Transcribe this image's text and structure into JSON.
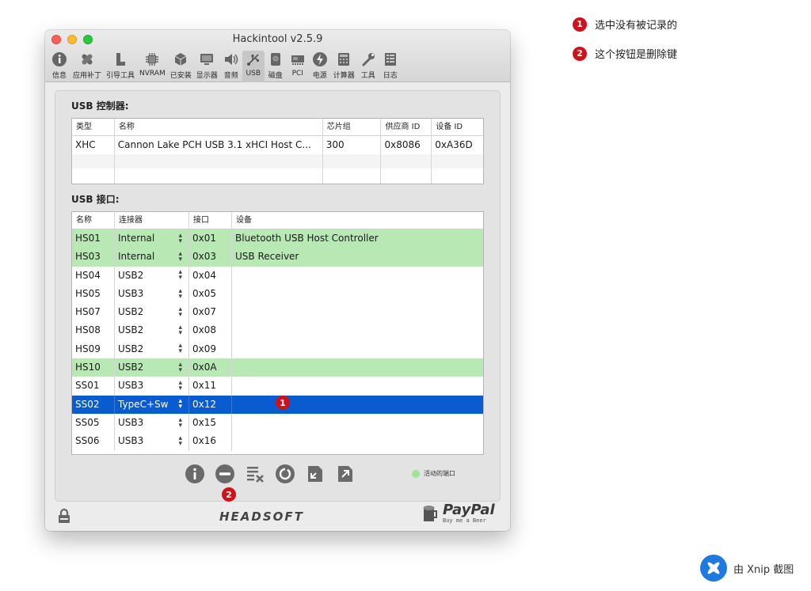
{
  "window": {
    "title": "Hackintool v2.5.9"
  },
  "toolbar": {
    "items": [
      {
        "label": "信息",
        "icon": "info-icon"
      },
      {
        "label": "应用补丁",
        "icon": "patch-icon"
      },
      {
        "label": "引导工具",
        "icon": "boot-icon"
      },
      {
        "label": "NVRAM",
        "icon": "chip-icon"
      },
      {
        "label": "已安装",
        "icon": "box-icon"
      },
      {
        "label": "显示器",
        "icon": "display-icon"
      },
      {
        "label": "音频",
        "icon": "speaker-icon"
      },
      {
        "label": "USB",
        "icon": "usb-icon",
        "active": true
      },
      {
        "label": "磁盘",
        "icon": "disk-icon"
      },
      {
        "label": "PCI",
        "icon": "pci-icon"
      },
      {
        "label": "电源",
        "icon": "power-icon"
      },
      {
        "label": "计算器",
        "icon": "calculator-icon"
      },
      {
        "label": "工具",
        "icon": "wrench-icon"
      },
      {
        "label": "日志",
        "icon": "log-icon"
      }
    ]
  },
  "controllers": {
    "title": "USB 控制器:",
    "headers": [
      "类型",
      "名称",
      "芯片组",
      "供应商 ID",
      "设备 ID"
    ],
    "rows": [
      [
        "XHC",
        "Cannon Lake PCH USB 3.1 xHCI Host C...",
        "300",
        "0x8086",
        "0xA36D"
      ]
    ]
  },
  "ports": {
    "title": "USB 接口:",
    "headers": [
      "名称",
      "连接器",
      "接口",
      "设备"
    ],
    "rows": [
      {
        "name": "HS01",
        "connector": "Internal",
        "port": "0x01",
        "device": "Bluetooth USB Host Controller",
        "state": "green"
      },
      {
        "name": "HS03",
        "connector": "Internal",
        "port": "0x03",
        "device": "USB Receiver",
        "state": "green"
      },
      {
        "name": "HS04",
        "connector": "USB2",
        "port": "0x04",
        "device": "",
        "state": ""
      },
      {
        "name": "HS05",
        "connector": "USB3",
        "port": "0x05",
        "device": "",
        "state": ""
      },
      {
        "name": "HS07",
        "connector": "USB2",
        "port": "0x07",
        "device": "",
        "state": ""
      },
      {
        "name": "HS08",
        "connector": "USB2",
        "port": "0x08",
        "device": "",
        "state": ""
      },
      {
        "name": "HS09",
        "connector": "USB2",
        "port": "0x09",
        "device": "",
        "state": ""
      },
      {
        "name": "HS10",
        "connector": "USB2",
        "port": "0x0A",
        "device": "",
        "state": "green"
      },
      {
        "name": "SS01",
        "connector": "USB3",
        "port": "0x11",
        "device": "",
        "state": ""
      },
      {
        "name": "SS02",
        "connector": "TypeC+Sw",
        "port": "0x12",
        "device": "",
        "state": "selected"
      },
      {
        "name": "SS05",
        "connector": "USB3",
        "port": "0x15",
        "device": "",
        "state": ""
      },
      {
        "name": "SS06",
        "connector": "USB3",
        "port": "0x16",
        "device": "",
        "state": ""
      }
    ]
  },
  "legend": {
    "label": "活动的端口",
    "color": "#9ee39a"
  },
  "footer": {
    "brand": "HEADSOFT",
    "paypal": "PayPal",
    "paypal_sub": "Buy me a Beer"
  },
  "markers": {
    "one": "1",
    "two": "2"
  },
  "notes": [
    {
      "num": "1",
      "text": "选中没有被记录的"
    },
    {
      "num": "2",
      "text": "这个按钮是删除键"
    }
  ],
  "watermark": "由 Xnip 截图",
  "colors": {
    "selected": "#0a5ad0",
    "active_port": "#b8e8b4",
    "marker": "#d0111b"
  }
}
